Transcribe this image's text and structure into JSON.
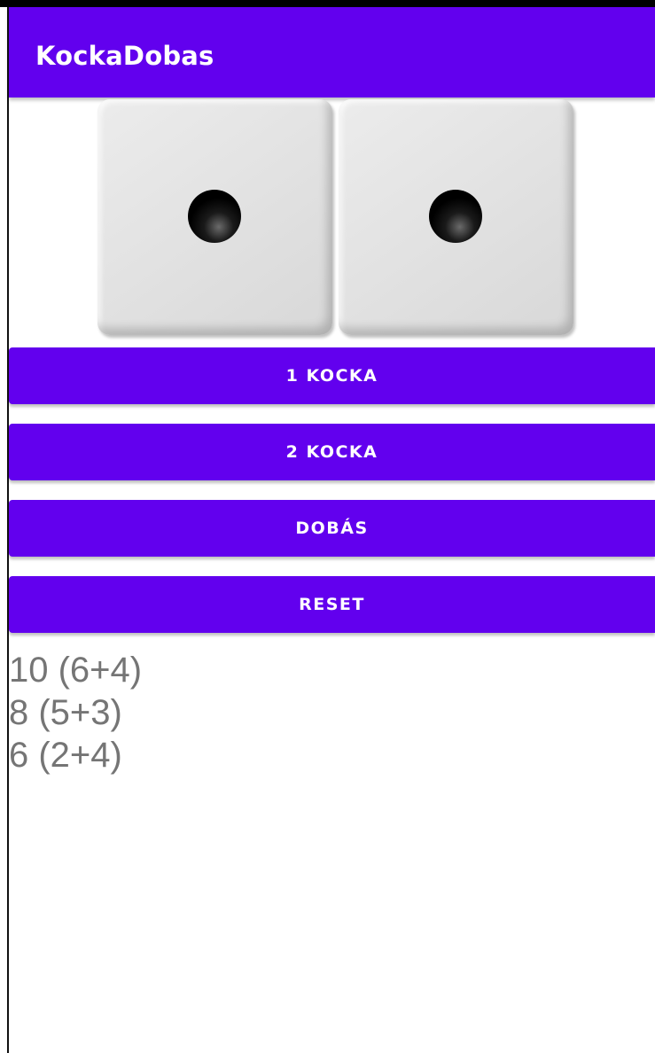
{
  "app_bar": {
    "title": "KockaDobas",
    "background": "#6200ee"
  },
  "dice": [
    {
      "value": 1,
      "pips": 1
    },
    {
      "value": 1,
      "pips": 1
    }
  ],
  "buttons": {
    "one_die": "1 KOCKA",
    "two_dice": "2 KOCKA",
    "roll": "DOBÁS",
    "reset": "RESET"
  },
  "history": [
    "10 (6+4)",
    "8 (5+3)",
    "6 (2+4)"
  ]
}
